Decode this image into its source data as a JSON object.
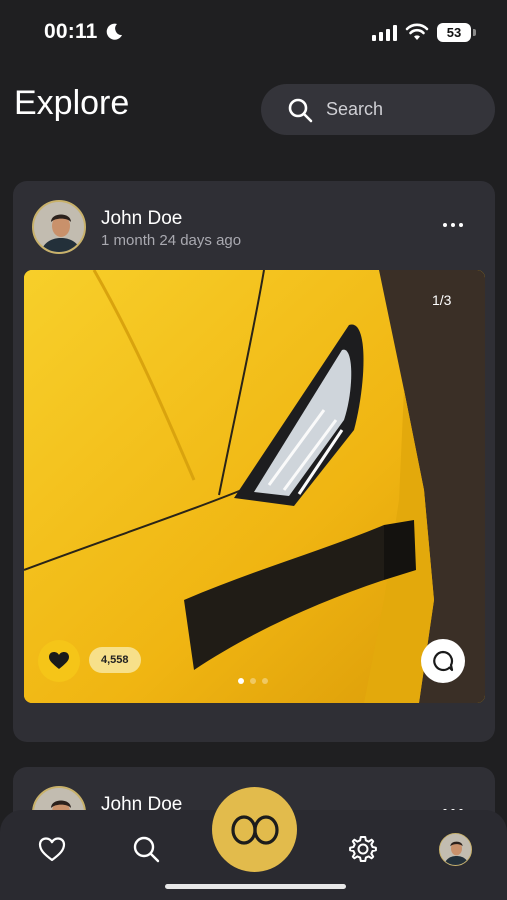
{
  "status_bar": {
    "time": "00:11",
    "battery": "53",
    "icons": [
      "moon-icon",
      "signal-icon",
      "wifi-icon",
      "battery-icon"
    ]
  },
  "header": {
    "title": "Explore",
    "search_placeholder": "Search"
  },
  "posts": [
    {
      "author": "John Doe",
      "time_ago": "1 month 24 days ago",
      "image_counter": "1/3",
      "likes": "4,558",
      "carousel_dots": 3,
      "active_dot": 0
    },
    {
      "author": "John Doe"
    }
  ],
  "bottom_nav": {
    "items": [
      "heart-icon",
      "search-icon",
      "home-logo",
      "settings-icon",
      "profile-avatar"
    ]
  },
  "colors": {
    "background": "#1f1f21",
    "card": "#2f2f35",
    "accent": "#e2bb4c",
    "like_yellow": "#f5c518"
  }
}
